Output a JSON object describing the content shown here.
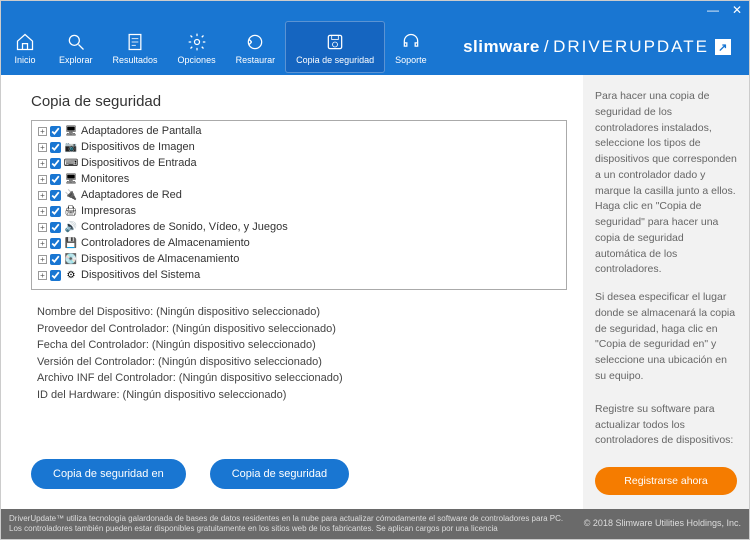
{
  "window": {
    "minimize": "—",
    "close": "✕"
  },
  "brand": {
    "name1": "slimware",
    "slash": "/",
    "name2": "DRIVERUPDATE",
    "launch": "↗"
  },
  "nav": {
    "inicio": "Inicio",
    "explorar": "Explorar",
    "resultados": "Resultados",
    "opciones": "Opciones",
    "restaurar": "Restaurar",
    "copia": "Copia de seguridad",
    "soporte": "Soporte"
  },
  "main": {
    "heading": "Copia de seguridad",
    "tree": [
      {
        "label": "Adaptadores de Pantalla",
        "icon": "🖥"
      },
      {
        "label": "Dispositivos de Imagen",
        "icon": "📷"
      },
      {
        "label": "Dispositivos de Entrada",
        "icon": "⌨"
      },
      {
        "label": "Monitores",
        "icon": "🖥"
      },
      {
        "label": "Adaptadores de Red",
        "icon": "🔌"
      },
      {
        "label": "Impresoras",
        "icon": "🖨"
      },
      {
        "label": "Controladores de Sonido, Vídeo, y Juegos",
        "icon": "🔊"
      },
      {
        "label": "Controladores de Almacenamiento",
        "icon": "💾"
      },
      {
        "label": "Dispositivos de Almacenamiento",
        "icon": "💽"
      },
      {
        "label": "Dispositivos del Sistema",
        "icon": "⚙"
      }
    ],
    "details": {
      "k0": "Nombre del Dispositivo:",
      "v0": "(Ningún dispositivo seleccionado)",
      "k1": "Proveedor del Controlador:",
      "v1": "(Ningún dispositivo seleccionado)",
      "k2": "Fecha del Controlador:",
      "v2": "(Ningún dispositivo seleccionado)",
      "k3": "Versión del Controlador:",
      "v3": "(Ningún dispositivo seleccionado)",
      "k4": "Archivo INF del Controlador:",
      "v4": "(Ningún dispositivo seleccionado)",
      "k5": "ID del Hardware:",
      "v5": "(Ningún dispositivo seleccionado)"
    },
    "btn_backup_in": "Copia de seguridad en",
    "btn_backup": "Copia de seguridad"
  },
  "sidebar": {
    "p1": "Para hacer una copia de seguridad de los controladores instalados, seleccione los tipos de dispositivos que corresponden a un controlador dado y marque la casilla junto a ellos. Haga clic en \"Copia de seguridad\" para hacer una copia de seguridad automática de los controladores.",
    "p2": "Si desea especificar el lugar donde se almacenará la copia de seguridad, haga clic en \"Copia de seguridad en\" y seleccione una ubicación en su equipo.",
    "p3": "Registre su software para actualizar todos los controladores de dispositivos:",
    "register": "Registrarse ahora"
  },
  "footer": {
    "disclaimer": "DriverUpdate™ utiliza tecnología galardonada de bases de datos residentes en la nube para actualizar cómodamente el software de controladores para PC. Los controladores también pueden estar disponibles gratuitamente en los sitios web de los fabricantes. Se aplican cargos por una licencia",
    "copyright": "© 2018 Slimware Utilities Holdings, Inc."
  }
}
